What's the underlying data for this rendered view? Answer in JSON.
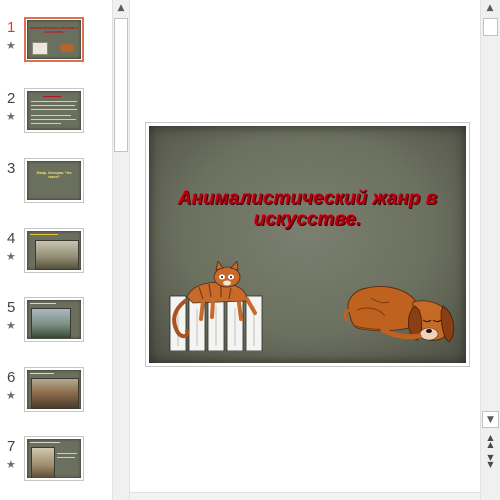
{
  "thumbnails": [
    {
      "number": "1",
      "star": "★",
      "title": "Анималистический жанр в искусстве."
    },
    {
      "number": "2",
      "star": "★"
    },
    {
      "number": "3",
      "star": "★",
      "text": "Жанр. История. Что такое?"
    },
    {
      "number": "4",
      "star": "★"
    },
    {
      "number": "5",
      "star": "★"
    },
    {
      "number": "6",
      "star": "★"
    },
    {
      "number": "7",
      "star": "★"
    }
  ],
  "slide": {
    "title": "Анималистический жанр в искусстве."
  },
  "scrollbars": {
    "thumb_up": "▲",
    "main_up": "▲",
    "main_down": "▼",
    "prev_slide": "▲▲",
    "next_slide": "▼▼"
  },
  "colors": {
    "title_red": "#b00010",
    "selected_border": "#e0704f",
    "slide_bg": "#6c705f",
    "active_number": "#d24726"
  }
}
